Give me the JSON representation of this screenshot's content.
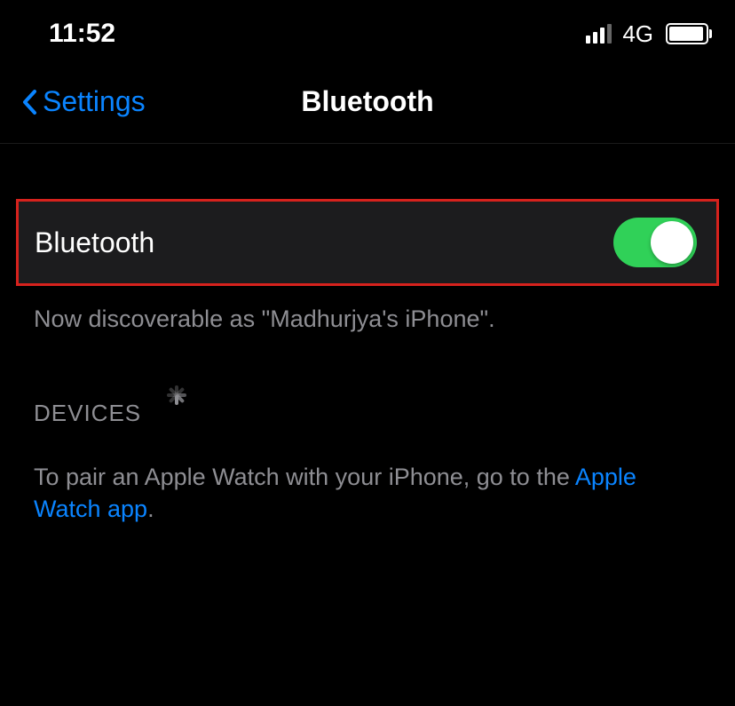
{
  "statusBar": {
    "time": "11:52",
    "networkType": "4G"
  },
  "nav": {
    "backLabel": "Settings",
    "title": "Bluetooth"
  },
  "bluetooth": {
    "label": "Bluetooth",
    "enabled": true,
    "discoverableText": "Now discoverable as \"Madhurjya's iPhone\"."
  },
  "devices": {
    "header": "DEVICES",
    "pairTextPrefix": "To pair an Apple Watch with your iPhone, go to the ",
    "pairLinkText": "Apple Watch app",
    "pairTextSuffix": "."
  }
}
